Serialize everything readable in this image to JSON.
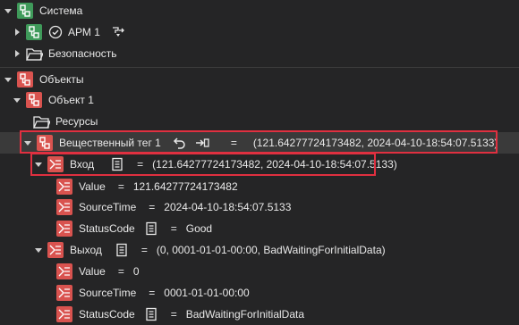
{
  "tree": {
    "system": {
      "label": "Система"
    },
    "arm": {
      "label": "АРМ 1"
    },
    "security": {
      "label": "Безопасность"
    },
    "objects": {
      "label": "Объекты"
    },
    "object1": {
      "label": "Объект 1"
    },
    "resources": {
      "label": "Ресурсы"
    },
    "tag": {
      "label": "Вещественный тег 1",
      "eq": "=",
      "value": "(121.64277724173482, 2024-04-10-18:54:07.5133)"
    },
    "input": {
      "label": "Вход",
      "eq": "=",
      "value": "(121.64277724173482, 2024-04-10-18:54:07.5133)",
      "fields": [
        {
          "name": "Value",
          "eq": "=",
          "value": "121.64277724173482"
        },
        {
          "name": "SourceTime",
          "eq": "=",
          "value": "2024-04-10-18:54:07.5133"
        },
        {
          "name": "StatusCode",
          "eq": "=",
          "value": "Good"
        }
      ]
    },
    "output": {
      "label": "Выход",
      "eq": "=",
      "value": "(0, 0001-01-01-00:00, BadWaitingForInitialData)",
      "fields": [
        {
          "name": "Value",
          "eq": "=",
          "value": "0"
        },
        {
          "name": "SourceTime",
          "eq": "=",
          "value": "0001-01-01-00:00"
        },
        {
          "name": "StatusCode",
          "eq": "=",
          "value": "BadWaitingForInitialData"
        }
      ]
    }
  },
  "colors": {
    "accent_green": "#4caf6a",
    "accent_red": "#d9534f",
    "highlight": "#e03040"
  }
}
